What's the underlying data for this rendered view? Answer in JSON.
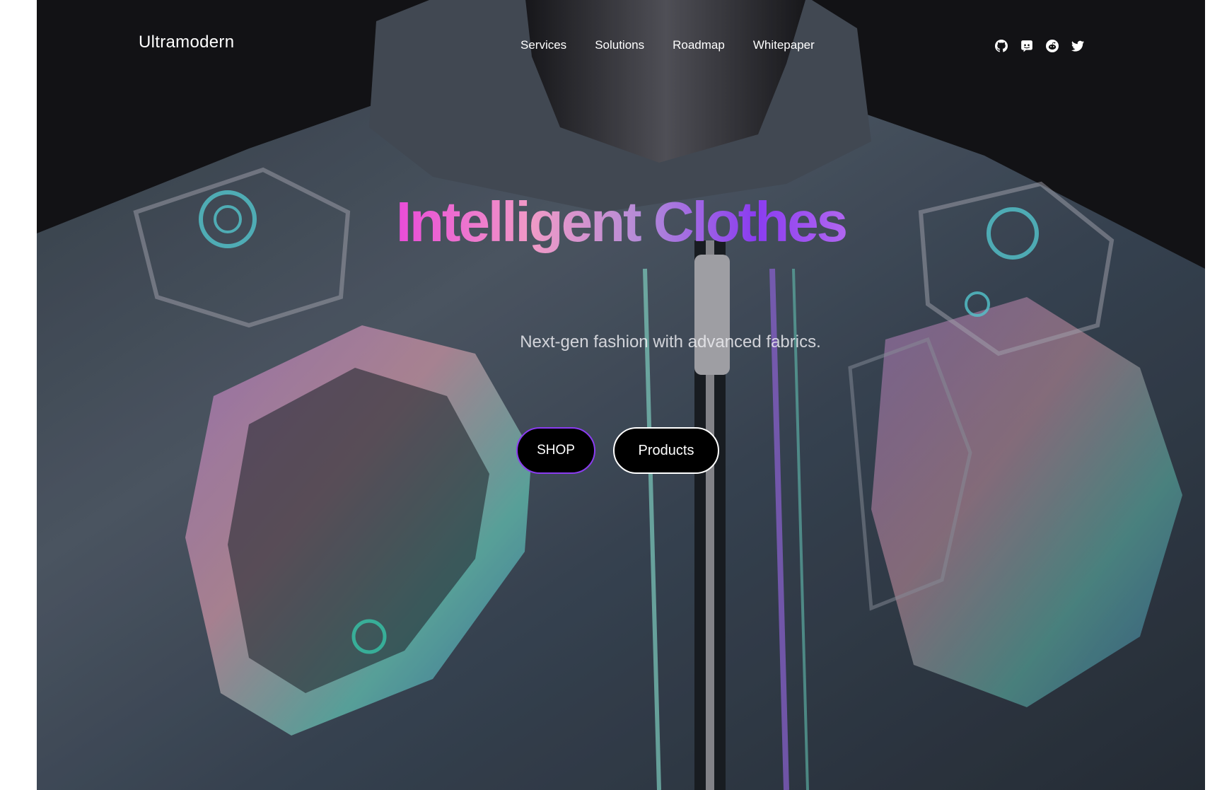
{
  "nav": {
    "logo": "Ultramodern",
    "links": [
      "Services",
      "Solutions",
      "Roadmap",
      "Whitepaper"
    ],
    "socials": [
      "github-icon",
      "discord-icon",
      "reddit-icon",
      "twitter-icon"
    ]
  },
  "hero": {
    "title": "Intelligent Clothes",
    "subtitle": "Next-gen fashion with advanced fabrics.",
    "primary_cta": "SHOP",
    "secondary_cta": "Products",
    "image_subject": "futuristic iridescent jacket on mannequin"
  },
  "colors": {
    "title_gradient_start": "#e94bd8",
    "title_gradient_end": "#8a3cf0",
    "shop_border": "#8a3cf0",
    "button_bg": "#000000"
  }
}
